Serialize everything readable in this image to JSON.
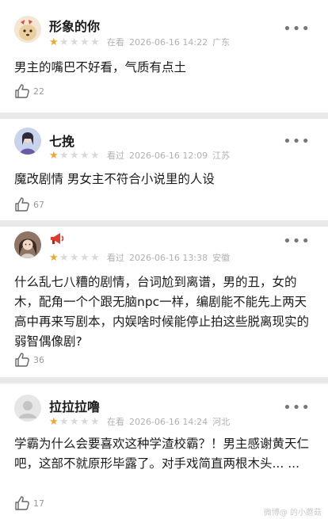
{
  "reviews": [
    {
      "name": "形象的你",
      "rating": 1,
      "status": "在看",
      "datetime": "2026-06-16 14:22",
      "location": "广东",
      "content": "男主的嘴巴不好看，气质有点土",
      "likes": "22"
    },
    {
      "name": "七挽",
      "rating": 1,
      "status": "看过",
      "datetime": "2026-06-16 12:09",
      "location": "江苏",
      "content": "魔改剧情 男女主不符合小说里的人设",
      "likes": "67"
    },
    {
      "name": "",
      "name_icon": "megaphone-icon",
      "rating": 1,
      "status": "看过",
      "datetime": "2026-06-16 13:38",
      "location": "安徽",
      "content": "什么乱七八糟的剧情，台词尬到离谱，男的丑，女的木，配角一个个跟无脑npc一样，编剧能不能先上两天高中再来写剧本，内娱啥时候能停止拍这些脱离现实的弱智偶像剧?",
      "likes": "36"
    },
    {
      "name": "拉拉拉噜",
      "rating": 1,
      "status": "在看",
      "datetime": "2026-06-16 14:24",
      "location": "河北",
      "content": "学霸为什么会要喜欢这种学渣校霸？！男主感谢黄天仁吧，这部不就原形毕露了。对手戏简直两根木头... ...",
      "likes": "17"
    }
  ],
  "more_label": "•••",
  "watermark": "微博@ 的小蘑菇"
}
